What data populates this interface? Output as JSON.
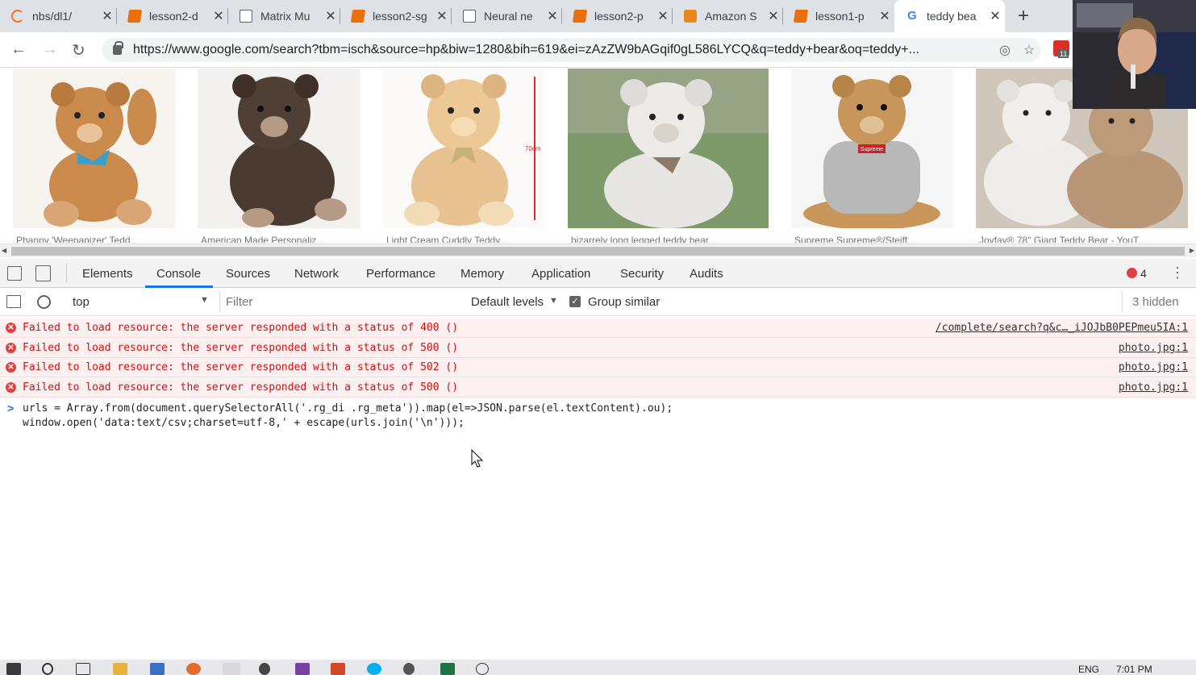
{
  "browser": {
    "tabs": [
      {
        "title": "nbs/dl1/",
        "icon": "jupyter-icon"
      },
      {
        "title": "lesson2-d",
        "icon": "notebook-icon"
      },
      {
        "title": "Matrix Mu",
        "icon": "document-icon"
      },
      {
        "title": "lesson2-sg",
        "icon": "notebook-icon"
      },
      {
        "title": "Neural ne",
        "icon": "document-icon"
      },
      {
        "title": "lesson2-p",
        "icon": "notebook-icon"
      },
      {
        "title": "Amazon S",
        "icon": "aws-box-icon"
      },
      {
        "title": "lesson1-p",
        "icon": "notebook-icon"
      },
      {
        "title": "teddy bea",
        "icon": "google-icon",
        "active": true
      }
    ],
    "new_tab": "+",
    "url": "https://www.google.com/search?tbm=isch&source=hp&biw=1280&bih=619&ei=zAzZW9bAGqif0gL586LYCQ&q=teddy+bear&oq=teddy+...",
    "extension_badge": "11"
  },
  "results": {
    "images": [
      {
        "alt": "teddy bear with blue bow",
        "color": "#c98a4b"
      },
      {
        "alt": "dark brown teddy bear",
        "color": "#4a3a30"
      },
      {
        "alt": "light cream teddy bear",
        "color": "#e8c290",
        "measure": "70cm"
      },
      {
        "alt": "white giant teddy on grass",
        "color": "#e8e6e2"
      },
      {
        "alt": "teddy bear with grey hoodie",
        "color": "#c8955a",
        "hoodie_text": "Supreme"
      },
      {
        "alt": "two giant teddy bears",
        "color": "#d8c4ac"
      }
    ],
    "captions": [
      "Phanpy 'Weepanizer' Tedd...",
      "American Made Personaliz...",
      "Light Cream Cuddly Teddy...",
      "bizarrely long legged teddy bear...",
      "Supreme Supreme®/Steiff...",
      "Joyfay® 78\" Giant Teddy Bear - YouT..."
    ]
  },
  "devtools": {
    "tabs": [
      "Elements",
      "Console",
      "Sources",
      "Network",
      "Performance",
      "Memory",
      "Application",
      "Security",
      "Audits"
    ],
    "active_tab": "Console",
    "error_count": "4",
    "context": "top",
    "filter_placeholder": "Filter",
    "levels": "Default levels",
    "group_similar": "Group similar",
    "hidden": "3 hidden",
    "messages": [
      {
        "text": "Failed to load resource: the server responded with a status of 400 ()",
        "source": "/complete/search?q&c…_iJOJbB0PEPmeu5IA:1"
      },
      {
        "text": "Failed to load resource: the server responded with a status of 500 ()",
        "source": "photo.jpg:1"
      },
      {
        "text": "Failed to load resource: the server responded with a status of 502 ()",
        "source": "photo.jpg:1"
      },
      {
        "text": "Failed to load resource: the server responded with a status of 500 ()",
        "source": "photo.jpg:1"
      }
    ],
    "input_line1": "urls = Array.from(document.querySelectorAll('.rg_di .rg_meta')).map(el=>JSON.parse(el.textContent).ou);",
    "input_line2": "window.open('data:text/csv;charset=utf-8,' + escape(urls.join('\\n')));",
    "prompt": ">"
  },
  "taskbar": {
    "lang": "ENG",
    "time": "7:01 PM"
  }
}
